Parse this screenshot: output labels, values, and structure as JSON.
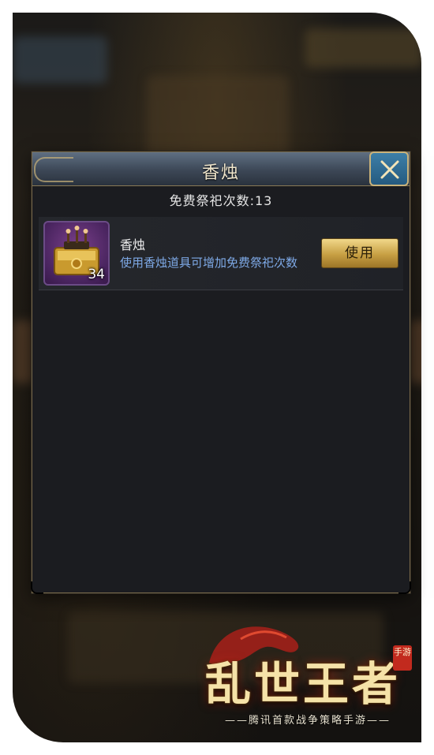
{
  "dialog": {
    "title": "香烛",
    "free_count_label": "免费祭祀次数:13"
  },
  "item": {
    "name": "香烛",
    "description": "使用香烛道具可增加免费祭祀次数",
    "count": "34",
    "use_label": "使用",
    "icon": "treasure-chest-candles-icon"
  },
  "logo": {
    "title": "乱世王者",
    "badge": "手游",
    "subtitle": "——腾讯首款战争策略手游——"
  },
  "colors": {
    "accent_gold": "#c9b27a",
    "description_blue": "#7ea9e6",
    "close_button_blue": "#2f6e96",
    "item_bg_purple": "#4a2560"
  }
}
